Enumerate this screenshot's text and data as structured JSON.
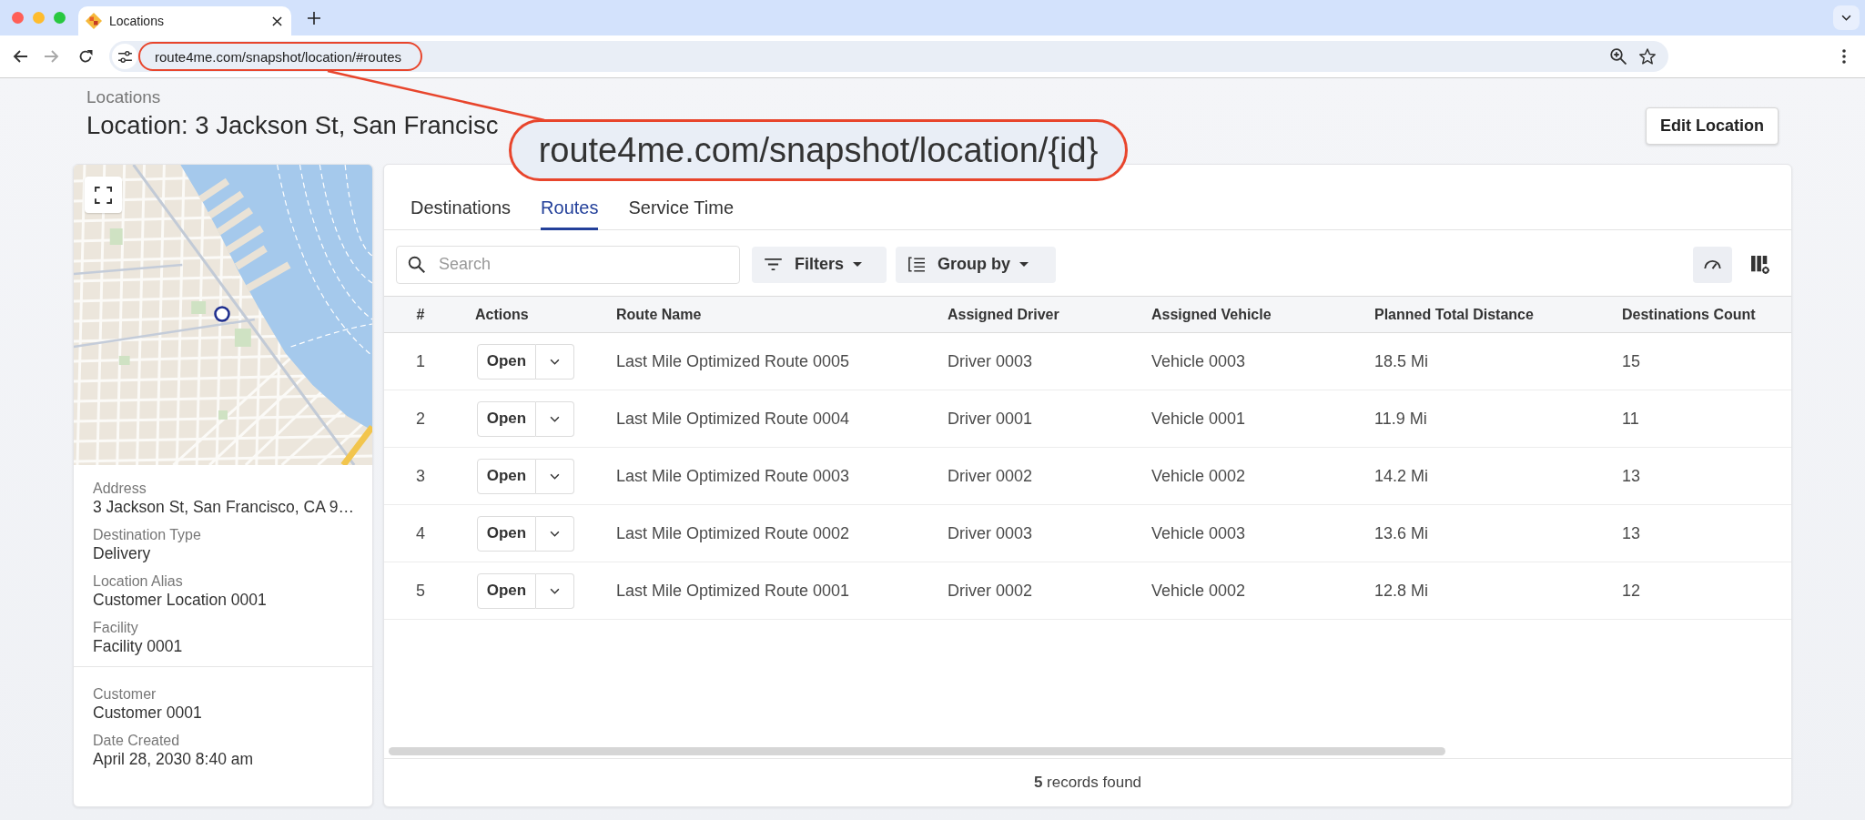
{
  "browser": {
    "tab_title": "Locations",
    "url": "route4me.com/snapshot/location/#routes",
    "back": {
      "disabled": false
    },
    "forward": {
      "disabled": true
    }
  },
  "annotation": {
    "callout": "route4me.com/snapshot/location/{id}"
  },
  "header": {
    "breadcrumb": "Locations",
    "title": "Location: 3 Jackson St, San Francisc",
    "edit_button": "Edit Location"
  },
  "details": {
    "sections": [
      {
        "fields": [
          {
            "label": "Address",
            "value": "3 Jackson St, San Francisco, CA 9…"
          },
          {
            "label": "Destination Type",
            "value": "Delivery"
          },
          {
            "label": "Location Alias",
            "value": "Customer Location 0001"
          },
          {
            "label": "Facility",
            "value": "Facility 0001"
          }
        ]
      },
      {
        "fields": [
          {
            "label": "Customer",
            "value": "Customer 0001"
          },
          {
            "label": "Date Created",
            "value": "April 28, 2030 8:40 am"
          }
        ]
      }
    ]
  },
  "tabs": [
    {
      "label": "Destinations",
      "selected": false
    },
    {
      "label": "Routes",
      "selected": true
    },
    {
      "label": "Service Time",
      "selected": false
    }
  ],
  "toolbar": {
    "search": {
      "placeholder": "Search"
    },
    "filters": "Filters",
    "group_by": "Group by"
  },
  "table": {
    "columns": [
      "#",
      "Actions",
      "Route Name",
      "Assigned Driver",
      "Assigned Vehicle",
      "Planned Total Distance",
      "Destinations Count"
    ],
    "rows": [
      {
        "number": "1",
        "action": "Open",
        "route_name": "Last Mile Optimized Route 0005",
        "driver": "Driver 0003",
        "vehicle": "Vehicle 0003",
        "distance": "18.5 Mi",
        "destinations_count": "15"
      },
      {
        "number": "2",
        "action": "Open",
        "route_name": "Last Mile Optimized Route 0004",
        "driver": "Driver 0001",
        "vehicle": "Vehicle 0001",
        "distance": "11.9 Mi",
        "destinations_count": "11"
      },
      {
        "number": "3",
        "action": "Open",
        "route_name": "Last Mile Optimized Route 0003",
        "driver": "Driver 0002",
        "vehicle": "Vehicle 0002",
        "distance": "14.2 Mi",
        "destinations_count": "13"
      },
      {
        "number": "4",
        "action": "Open",
        "route_name": "Last Mile Optimized Route 0002",
        "driver": "Driver 0003",
        "vehicle": "Vehicle 0003",
        "distance": "13.6 Mi",
        "destinations_count": "13"
      },
      {
        "number": "5",
        "action": "Open",
        "route_name": "Last Mile Optimized Route 0001",
        "driver": "Driver 0002",
        "vehicle": "Vehicle 0002",
        "distance": "12.8 Mi",
        "destinations_count": "12"
      }
    ]
  },
  "footer": {
    "summary": "**5** records found"
  }
}
